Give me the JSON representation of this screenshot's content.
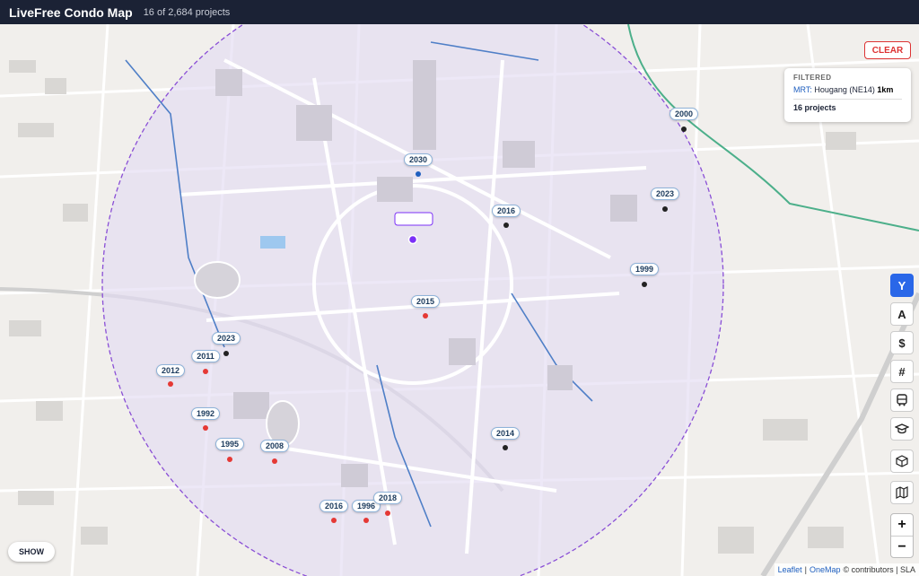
{
  "header": {
    "title": "LiveFree Condo Map",
    "count": "16 of 2,684 projects"
  },
  "controls": {
    "clear_label": "CLEAR",
    "show_label": "SHOW",
    "tools": [
      {
        "label": "Y",
        "active": true
      },
      {
        "label": "A"
      },
      {
        "label": "$"
      },
      {
        "label": "#"
      },
      {
        "label": "",
        "icon": "bus-icon"
      },
      {
        "label": "",
        "icon": "graduation-cap-icon"
      },
      {
        "label": "",
        "icon": "cube-icon"
      },
      {
        "label": "",
        "icon": "map-icon"
      }
    ],
    "zoom_in": "+",
    "zoom_out": "−"
  },
  "filter": {
    "heading": "FILTERED",
    "mrt_key": "MRT:",
    "mrt_value": "Hougang (NE14)",
    "radius": "1km",
    "projects": "16 projects"
  },
  "map": {
    "center_station": "Hougang (NE14)",
    "radius_km": 1,
    "colors": {
      "circle_fill": "#e4dcf2",
      "circle_stroke": "#8a4fd6",
      "marker_red": "#e53935",
      "marker_dark": "#222222",
      "marker_blue": "#1f5fbf",
      "station": "#7b2ff7"
    },
    "pins": [
      {
        "year": "2030",
        "marker": "blue"
      },
      {
        "year": "2016",
        "marker": "dark"
      },
      {
        "year": "2000",
        "marker": "dark"
      },
      {
        "year": "2023",
        "marker": "dark"
      },
      {
        "year": "1999",
        "marker": "dark"
      },
      {
        "year": "2015",
        "marker": "red"
      },
      {
        "year": "2023",
        "marker": "dark"
      },
      {
        "year": "2011",
        "marker": "red"
      },
      {
        "year": "2012",
        "marker": "red"
      },
      {
        "year": "1992",
        "marker": "red"
      },
      {
        "year": "1995",
        "marker": "red"
      },
      {
        "year": "2008",
        "marker": "red"
      },
      {
        "year": "2014",
        "marker": "dark"
      },
      {
        "year": "2016",
        "marker": "red"
      },
      {
        "year": "1996",
        "marker": "red"
      },
      {
        "year": "2018",
        "marker": "red"
      }
    ]
  },
  "attribution": {
    "leaflet": "Leaflet",
    "onemap": "OneMap",
    "rest": "© contributors | SLA"
  }
}
